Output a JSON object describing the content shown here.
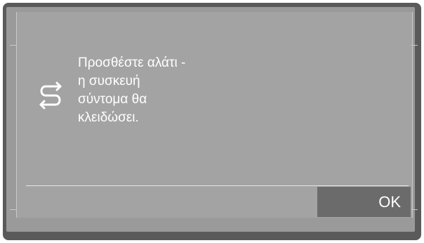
{
  "dialog": {
    "icon": "swap-arrows-icon",
    "message_lines": [
      "Προσθέστε αλάτι -",
      "η συσκευή",
      "σύντομα θα",
      "κλειδώσει."
    ],
    "ok_label": "OK"
  },
  "colors": {
    "bezel": "#5a5a5a",
    "screen": "#9a9a9a",
    "panel": "#a3a3a3",
    "button": "#6b6b6b",
    "text": "#ffffff"
  }
}
